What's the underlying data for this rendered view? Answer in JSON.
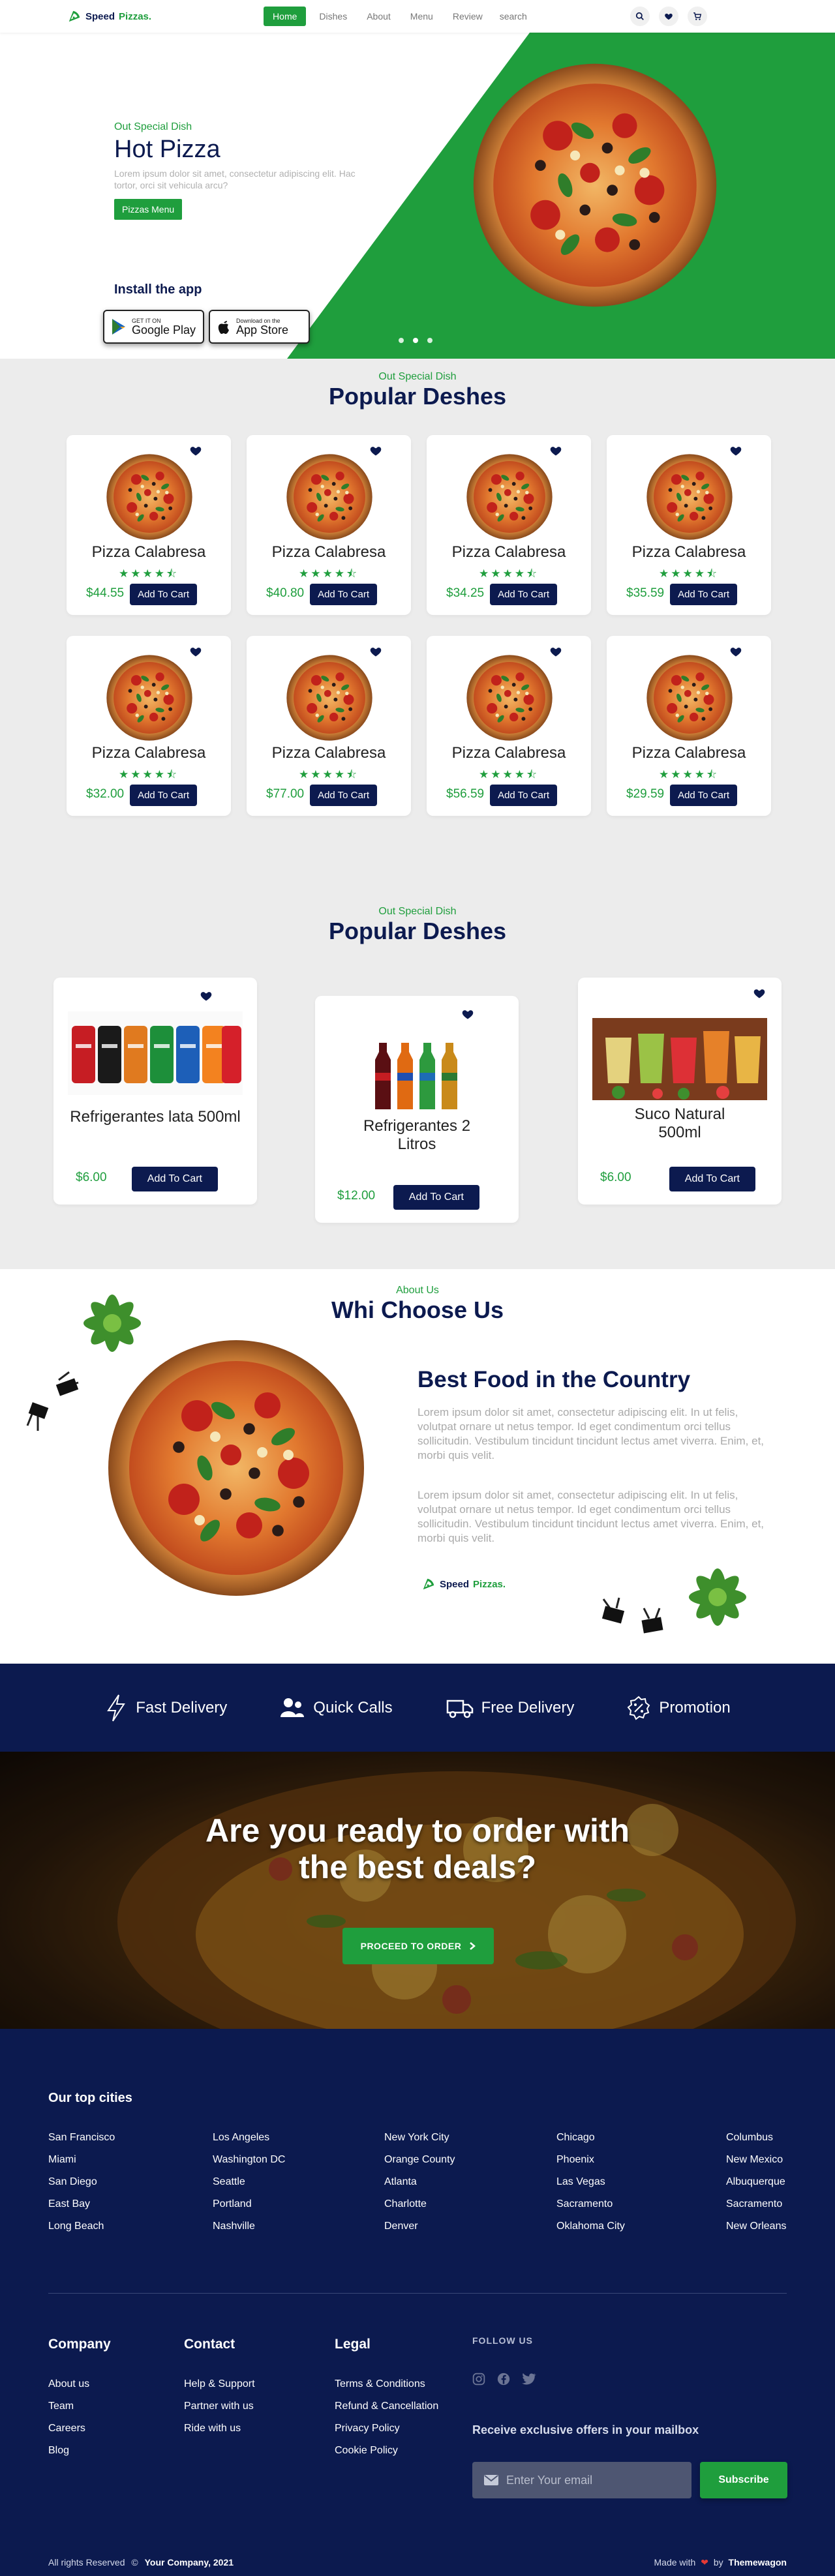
{
  "nav": {
    "brand_main": "Speed",
    "brand_accent": "Pizzas.",
    "links": [
      "Home",
      "Dishes",
      "About",
      "Menu",
      "Review"
    ],
    "search_placeholder": "search",
    "icons": [
      "search-icon",
      "heart-icon",
      "cart-icon"
    ]
  },
  "hero": {
    "kicker": "Out Special Dish",
    "title": "Hot Pizza",
    "description": "Lorem ipsum dolor sit amet, consectetur adipiscing elit. Hac tortor, orci sit vehicula arcu?",
    "button": "Pizzas Menu",
    "install_title": "Install the app",
    "google_small": "GET IT ON",
    "google_big": "Google Play",
    "apple_small": "Download on the",
    "apple_big": "App Store",
    "slide_count": 3
  },
  "dishes": {
    "kicker": "Out Special Dish",
    "title": "Popular Deshes",
    "cart_label": "Add To Cart",
    "items": [
      {
        "name": "Pizza Calabresa",
        "price": "$44.55",
        "rating": 4.5
      },
      {
        "name": "Pizza Calabresa",
        "price": "$40.80",
        "rating": 4.5
      },
      {
        "name": "Pizza Calabresa",
        "price": "$34.25",
        "rating": 4.5
      },
      {
        "name": "Pizza Calabresa",
        "price": "$35.59",
        "rating": 4.5
      },
      {
        "name": "Pizza Calabresa",
        "price": "$32.00",
        "rating": 4.5
      },
      {
        "name": "Pizza Calabresa",
        "price": "$77.00",
        "rating": 4.5
      },
      {
        "name": "Pizza Calabresa",
        "price": "$56.59",
        "rating": 4.5
      },
      {
        "name": "Pizza Calabresa",
        "price": "$29.59",
        "rating": 4.5
      }
    ]
  },
  "drinks": {
    "kicker": "Out Special Dish",
    "title": "Popular Deshes",
    "cart_label": "Add To Cart",
    "items": [
      {
        "name": "Refrigerantes lata 500ml",
        "price": "$6.00"
      },
      {
        "name": "Refrigerantes 2 Litros",
        "price": "$12.00"
      },
      {
        "name": "Suco Natural 500ml",
        "price": "$6.00"
      }
    ]
  },
  "why": {
    "kicker": "About Us",
    "title": "Whi Choose Us",
    "heading": "Best Food in the Country",
    "p1": "Lorem ipsum dolor sit amet, consectetur adipiscing elit. In ut felis, volutpat ornare ut netus tempor. Id eget condimentum orci tellus sollicitudin. Vestibulum tincidunt tincidunt lectus amet viverra. Enim, et, morbi quis velit.",
    "p2": "Lorem ipsum dolor sit amet, consectetur adipiscing elit. In ut felis, volutpat ornare ut netus tempor. Id eget condimentum orci tellus sollicitudin. Vestibulum tincidunt tincidunt lectus amet viverra. Enim, et, morbi quis velit.",
    "brand_main": "Speed",
    "brand_accent": "Pizzas."
  },
  "features": [
    {
      "label": "Fast Delivery",
      "icon": "lightning-icon"
    },
    {
      "label": "Quick Calls",
      "icon": "users-icon"
    },
    {
      "label": "Free Delivery",
      "icon": "truck-icon"
    },
    {
      "label": "Promotion",
      "icon": "percent-badge-icon"
    }
  ],
  "cta": {
    "line1": "Are you ready to order with",
    "line2": "the best deals?",
    "button": "PROCEED TO ORDER"
  },
  "footer": {
    "cities_title": "Our top cities",
    "cities": [
      [
        "San Francisco",
        "Miami",
        "San Diego",
        "East Bay",
        "Long Beach"
      ],
      [
        "Los Angeles",
        "Washington DC",
        "Seattle",
        "Portland",
        "Nashville"
      ],
      [
        "New York City",
        "Orange County",
        "Atlanta",
        "Charlotte",
        "Denver"
      ],
      [
        "Chicago",
        "Phoenix",
        "Las Vegas",
        "Sacramento",
        "Oklahoma City"
      ],
      [
        "Columbus",
        "New Mexico",
        "Albuquerque",
        "Sacramento",
        "New Orleans"
      ]
    ],
    "company": {
      "title": "Company",
      "links": [
        "About us",
        "Team",
        "Careers",
        "Blog"
      ]
    },
    "contact": {
      "title": "Contact",
      "links": [
        "Help & Support",
        "Partner with us",
        "Ride with us"
      ]
    },
    "legal": {
      "title": "Legal",
      "links": [
        "Terms & Conditions",
        "Refund & Cancellation",
        "Privacy Policy",
        "Cookie Policy"
      ]
    },
    "follow": "FOLLOW US",
    "offer": "Receive exclusive offers in your mailbox",
    "email_placeholder": "Enter Your email",
    "subscribe": "Subscribe",
    "rights": "All rights Reserved",
    "company_name": "Your Company, 2021",
    "made_with": "Made with",
    "by": "by",
    "author": "Themewagon"
  },
  "colors": {
    "green": "#1f9e3d",
    "navy": "#0c1a4f",
    "grey_bg": "#ececec"
  }
}
